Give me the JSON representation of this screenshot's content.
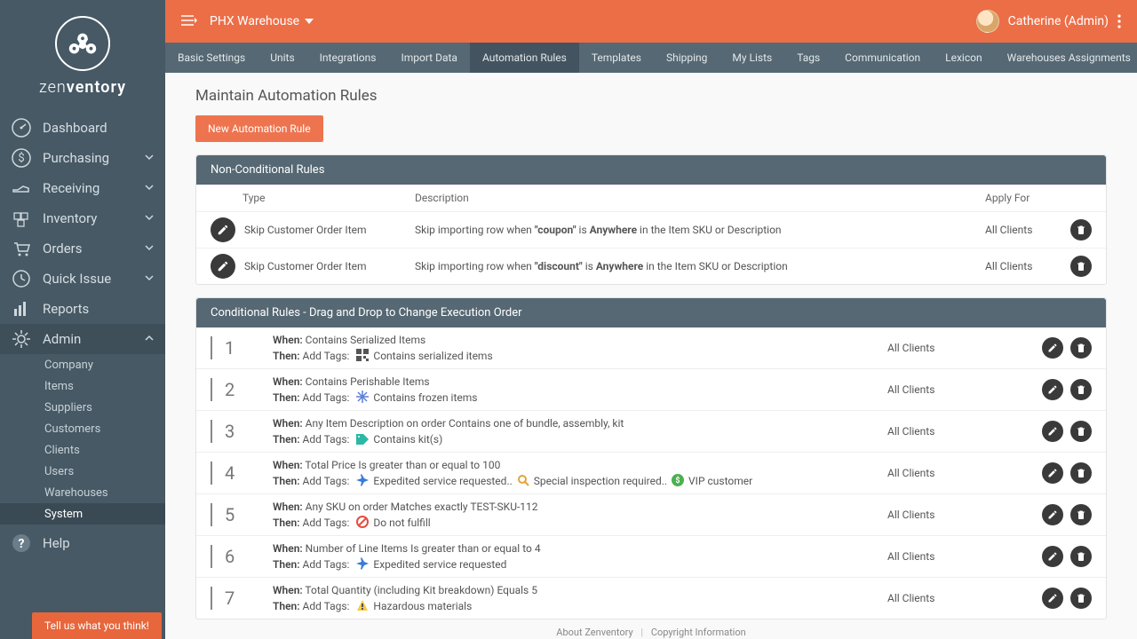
{
  "brand": {
    "name_light": "zen",
    "name_bold": "ventory"
  },
  "sidebar": {
    "items": [
      {
        "label": "Dashboard",
        "icon": "speedometer"
      },
      {
        "label": "Purchasing",
        "icon": "dollar",
        "expandable": true
      },
      {
        "label": "Receiving",
        "icon": "hand",
        "expandable": true
      },
      {
        "label": "Inventory",
        "icon": "boxes",
        "expandable": true
      },
      {
        "label": "Orders",
        "icon": "cart",
        "expandable": true
      },
      {
        "label": "Quick Issue",
        "icon": "clock",
        "expandable": true
      },
      {
        "label": "Reports",
        "icon": "bars"
      },
      {
        "label": "Admin",
        "icon": "gear",
        "expandable": true,
        "expanded": true
      }
    ],
    "admin_sub": [
      "Company",
      "Items",
      "Suppliers",
      "Customers",
      "Clients",
      "Users",
      "Warehouses",
      "System"
    ],
    "admin_active": "System",
    "help": "Help",
    "feedback": "Tell us what you think!"
  },
  "topbar": {
    "warehouse": "PHX Warehouse",
    "user": "Catherine (Admin)"
  },
  "tabs": [
    "Basic Settings",
    "Units",
    "Integrations",
    "Import Data",
    "Automation Rules",
    "Templates",
    "Shipping",
    "My Lists",
    "Tags",
    "Communication",
    "Lexicon",
    "Warehouses Assignments"
  ],
  "active_tab": "Automation Rules",
  "page": {
    "title": "Maintain Automation Rules",
    "new_btn": "New Automation Rule",
    "nc_header": "Non-Conditional Rules",
    "cond_header": "Conditional Rules - Drag and Drop to Change Execution Order",
    "cols": {
      "type": "Type",
      "desc": "Description",
      "apply": "Apply For"
    },
    "nc_rows": [
      {
        "type": "Skip Customer Order Item",
        "desc_pre": "Skip importing row when ",
        "kw": "\"coupon\"",
        "mid": " is ",
        "kw2": "Anywhere",
        "suf": " in the Item SKU or Description",
        "apply": "All Clients"
      },
      {
        "type": "Skip Customer Order Item",
        "desc_pre": "Skip importing row when ",
        "kw": "\"discount\"",
        "mid": " is ",
        "kw2": "Anywhere",
        "suf": " in the Item SKU or Description",
        "apply": "All Clients"
      }
    ],
    "cond_rows": [
      {
        "n": "1",
        "when": "Contains Serialized Items",
        "then": "Add Tags:",
        "tags": [
          {
            "icon": "qr",
            "text": "Contains serialized items"
          }
        ],
        "apply": "All Clients"
      },
      {
        "n": "2",
        "when": "Contains Perishable Items",
        "then": "Add Tags:",
        "tags": [
          {
            "icon": "snow",
            "text": "Contains frozen items"
          }
        ],
        "apply": "All Clients"
      },
      {
        "n": "3",
        "when": "Any Item Description on order Contains one of bundle, assembly, kit",
        "then": "Add Tags:",
        "tags": [
          {
            "icon": "tag",
            "text": "Contains kit(s)"
          }
        ],
        "apply": "All Clients"
      },
      {
        "n": "4",
        "when": "Total Price Is greater than or equal to 100",
        "then": "Add Tags:",
        "tags": [
          {
            "icon": "plane",
            "text": "Expedited service requested."
          },
          {
            "icon": "search",
            "text": "Special inspection required."
          },
          {
            "icon": "dollar",
            "text": "VIP customer"
          }
        ],
        "apply": "All Clients"
      },
      {
        "n": "5",
        "when": "Any SKU on order Matches exactly TEST-SKU-112",
        "then": "Add Tags:",
        "tags": [
          {
            "icon": "nofulfill",
            "text": "Do not fulfill"
          }
        ],
        "apply": "All Clients"
      },
      {
        "n": "6",
        "when": "Number of Line Items Is greater than or equal to 4",
        "then": "Add Tags:",
        "tags": [
          {
            "icon": "plane",
            "text": "Expedited service requested"
          }
        ],
        "apply": "All Clients"
      },
      {
        "n": "7",
        "when": "Total Quantity (including Kit breakdown) Equals 5",
        "then": "Add Tags:",
        "tags": [
          {
            "icon": "haz",
            "text": "Hazardous materials"
          }
        ],
        "apply": "All Clients"
      }
    ]
  },
  "footer": {
    "about": "About Zenventory",
    "copy": "Copyright Information"
  }
}
